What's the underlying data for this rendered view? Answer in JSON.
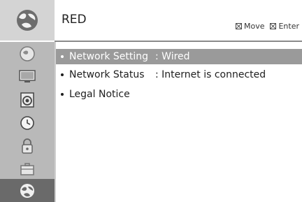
{
  "header": {
    "title": "RED",
    "icon": "globe-icon",
    "hints": [
      {
        "icon": "move-key-icon",
        "label": "Move"
      },
      {
        "icon": "enter-key-icon",
        "label": "Enter"
      }
    ]
  },
  "sidebar": {
    "items": [
      {
        "icon": "picture-icon",
        "selected": false
      },
      {
        "icon": "screen-icon",
        "selected": false
      },
      {
        "icon": "sound-icon",
        "selected": false
      },
      {
        "icon": "clock-icon",
        "selected": false
      },
      {
        "icon": "lock-icon",
        "selected": false
      },
      {
        "icon": "toolbox-icon",
        "selected": false
      },
      {
        "icon": "network-globe-icon",
        "selected": true
      }
    ]
  },
  "menu": {
    "items": [
      {
        "label": "Network Setting",
        "value": ": Wired",
        "selected": true
      },
      {
        "label": "Network Status",
        "value": ": Internet is connected",
        "selected": false
      },
      {
        "label": "Legal Notice",
        "value": "",
        "selected": false
      }
    ]
  },
  "colors": {
    "sidebar_bg": "#b9b9b9",
    "sidebar_selected": "#6a6a6a",
    "row_selected": "#9a9a9a",
    "header_icon_bg": "#d4d4d4"
  }
}
